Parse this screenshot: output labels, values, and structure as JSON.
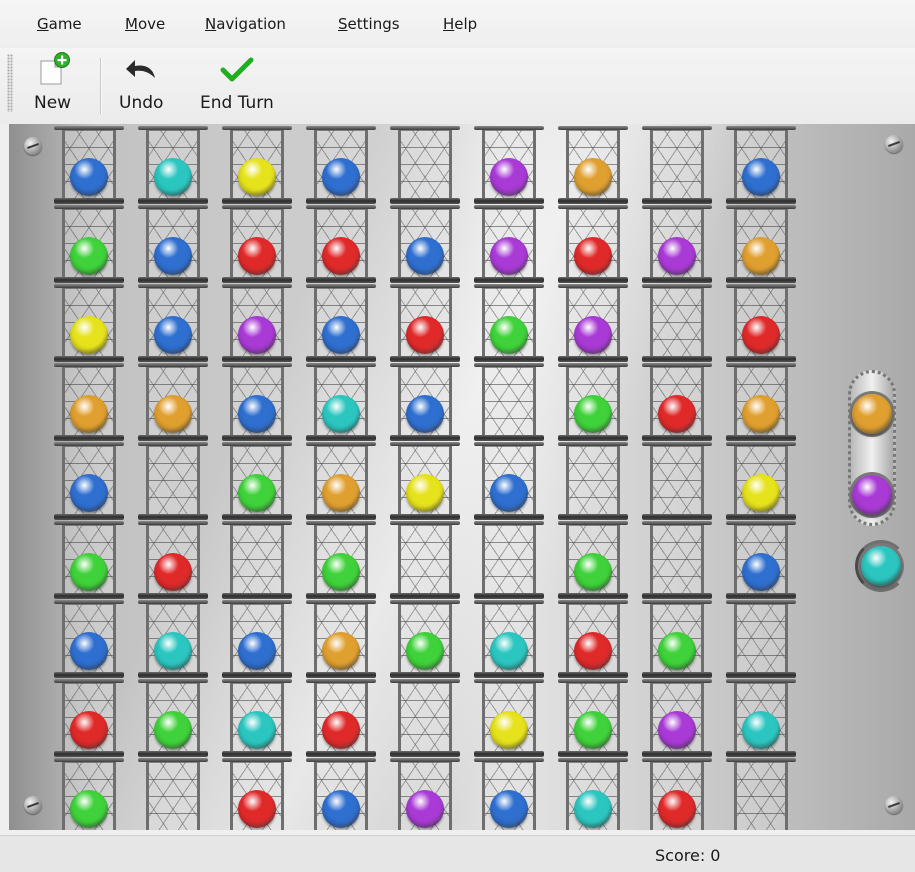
{
  "menu": [
    "Game",
    "Move",
    "Navigation",
    "Settings",
    "Help"
  ],
  "menu_accel": [
    "G",
    "M",
    "N",
    "S",
    "H"
  ],
  "toolbar": {
    "new_label": "New",
    "undo_label": "Undo",
    "end_turn_label": "End Turn"
  },
  "board": {
    "columns": 9,
    "rows": 9,
    "colors": {
      "B": "#2f6fd0",
      "C": "#2cc6c0",
      "Y": "#e6e21c",
      "P": "#a93ad6",
      "O": "#e0a030",
      "G": "#3fd23a",
      "R": "#e02a2a"
    },
    "cells": [
      [
        "B",
        "C",
        "Y",
        "B",
        "",
        "P",
        "O",
        "",
        "B"
      ],
      [
        "G",
        "B",
        "R",
        "R",
        "B",
        "P",
        "R",
        "P",
        "O"
      ],
      [
        "Y",
        "B",
        "P",
        "B",
        "R",
        "G",
        "P",
        "",
        "R"
      ],
      [
        "O",
        "O",
        "B",
        "C",
        "B",
        "",
        "G",
        "R",
        "O"
      ],
      [
        "B",
        "",
        "G",
        "O",
        "Y",
        "B",
        "",
        "",
        "Y"
      ],
      [
        "G",
        "R",
        "",
        "G",
        "",
        "",
        "G",
        "",
        "B"
      ],
      [
        "B",
        "C",
        "B",
        "O",
        "G",
        "C",
        "R",
        "G",
        ""
      ],
      [
        "R",
        "G",
        "C",
        "R",
        "",
        "Y",
        "G",
        "P",
        "C"
      ],
      [
        "G",
        "",
        "R",
        "B",
        "P",
        "B",
        "C",
        "R",
        ""
      ]
    ]
  },
  "next_balls": [
    "O",
    "P",
    "C"
  ],
  "status": {
    "score_text": "Score: 0"
  }
}
